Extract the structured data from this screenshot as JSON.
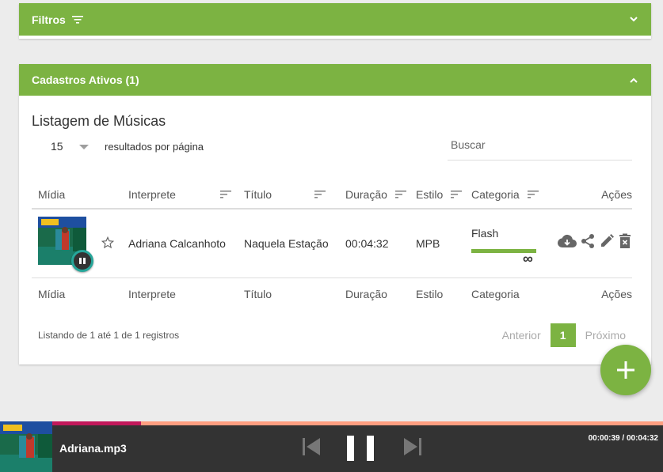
{
  "filters": {
    "title": "Filtros"
  },
  "cadastros": {
    "title": "Cadastros Ativos (1)",
    "list_title": "Listagem de Músicas",
    "per_page_value": "15",
    "per_page_label": "resultados por página",
    "search_placeholder": "Buscar",
    "columns": [
      "Mídia",
      "Interprete",
      "Título",
      "Duração",
      "Estilo",
      "Categoria",
      "Ações"
    ],
    "rows": [
      {
        "interprete": "Adriana Calcanhoto",
        "titulo": "Naquela Estação",
        "duracao": "00:04:32",
        "estilo": "MPB",
        "categoria": "Flash",
        "categoria_extra": "∞"
      }
    ],
    "info": "Listando de 1 até 1 de 1 registros",
    "pager": {
      "prev": "Anterior",
      "current": "1",
      "next": "Próximo"
    }
  },
  "player": {
    "title": "Adriana.mp3",
    "time": "00:00:39 / 00:04:32",
    "progress": 0.213
  },
  "colors": {
    "accent": "#7cb342",
    "player_bg": "#333333",
    "progress_track": "#ff9e80",
    "progress_fill": "#c2185b",
    "play_ring": "#26a69a"
  },
  "icons": [
    "sort-icon",
    "chevron-down-icon",
    "chevron-up-icon",
    "pause-icon",
    "star-outline-icon",
    "cloud-download-icon",
    "share-icon",
    "pencil-icon",
    "trash-icon",
    "plus-icon",
    "skip-previous-icon",
    "skip-next-icon"
  ]
}
